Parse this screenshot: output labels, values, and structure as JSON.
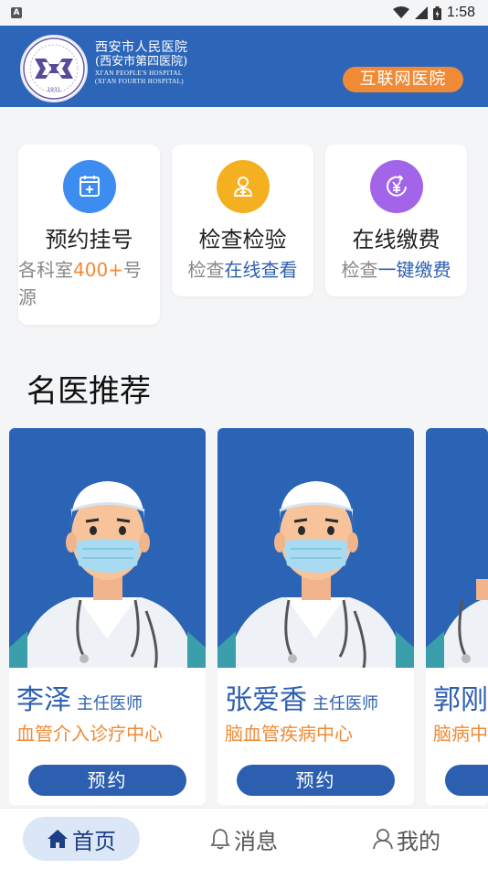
{
  "status_bar": {
    "left_badge": "A",
    "time": "1:58"
  },
  "header": {
    "hospital_name_cn": "西安市人民医院",
    "hospital_name_cn_sub": "(西安市第四医院)",
    "hospital_name_en": "XI'AN PEOPLE'S HOSPITAL",
    "hospital_name_en_sub": "(XI'AN FOURTH HOSPITAL)",
    "logo_year": "1931",
    "badge": "互联网医院"
  },
  "services": [
    {
      "title": "预约挂号",
      "sub_pre": "各科室",
      "sub_highlight": "400+",
      "sub_post": "号源",
      "icon": "calendar-plus-icon",
      "color": "#3d8cf0"
    },
    {
      "title": "检查检验",
      "sub_pre": "检查",
      "sub_highlight": "在线查看",
      "sub_post": "",
      "icon": "test-report-icon",
      "color": "#f5b021"
    },
    {
      "title": "在线缴费",
      "sub_pre": "检查",
      "sub_highlight": "一键缴费",
      "sub_post": "",
      "icon": "yuan-payment-icon",
      "color": "#a264e8"
    }
  ],
  "section_title": "名医推荐",
  "doctors": [
    {
      "name": "李泽",
      "title": "主任医师",
      "dept": "血管介入诊疗中心",
      "button": "预约"
    },
    {
      "name": "张爱香",
      "title": "主任医师",
      "dept": "脑血管疾病中心",
      "button": "预约"
    },
    {
      "name": "郭刚",
      "title": "",
      "dept": "脑病中",
      "button": ""
    }
  ],
  "nav": [
    {
      "label": "首页",
      "icon": "home-icon",
      "active": true
    },
    {
      "label": "消息",
      "icon": "bell-icon",
      "active": false
    },
    {
      "label": "我的",
      "icon": "user-icon",
      "active": false
    }
  ],
  "colors": {
    "primary": "#2d66b8",
    "accent_orange": "#f08a35",
    "nav_active_bg": "#dbe6f6"
  }
}
